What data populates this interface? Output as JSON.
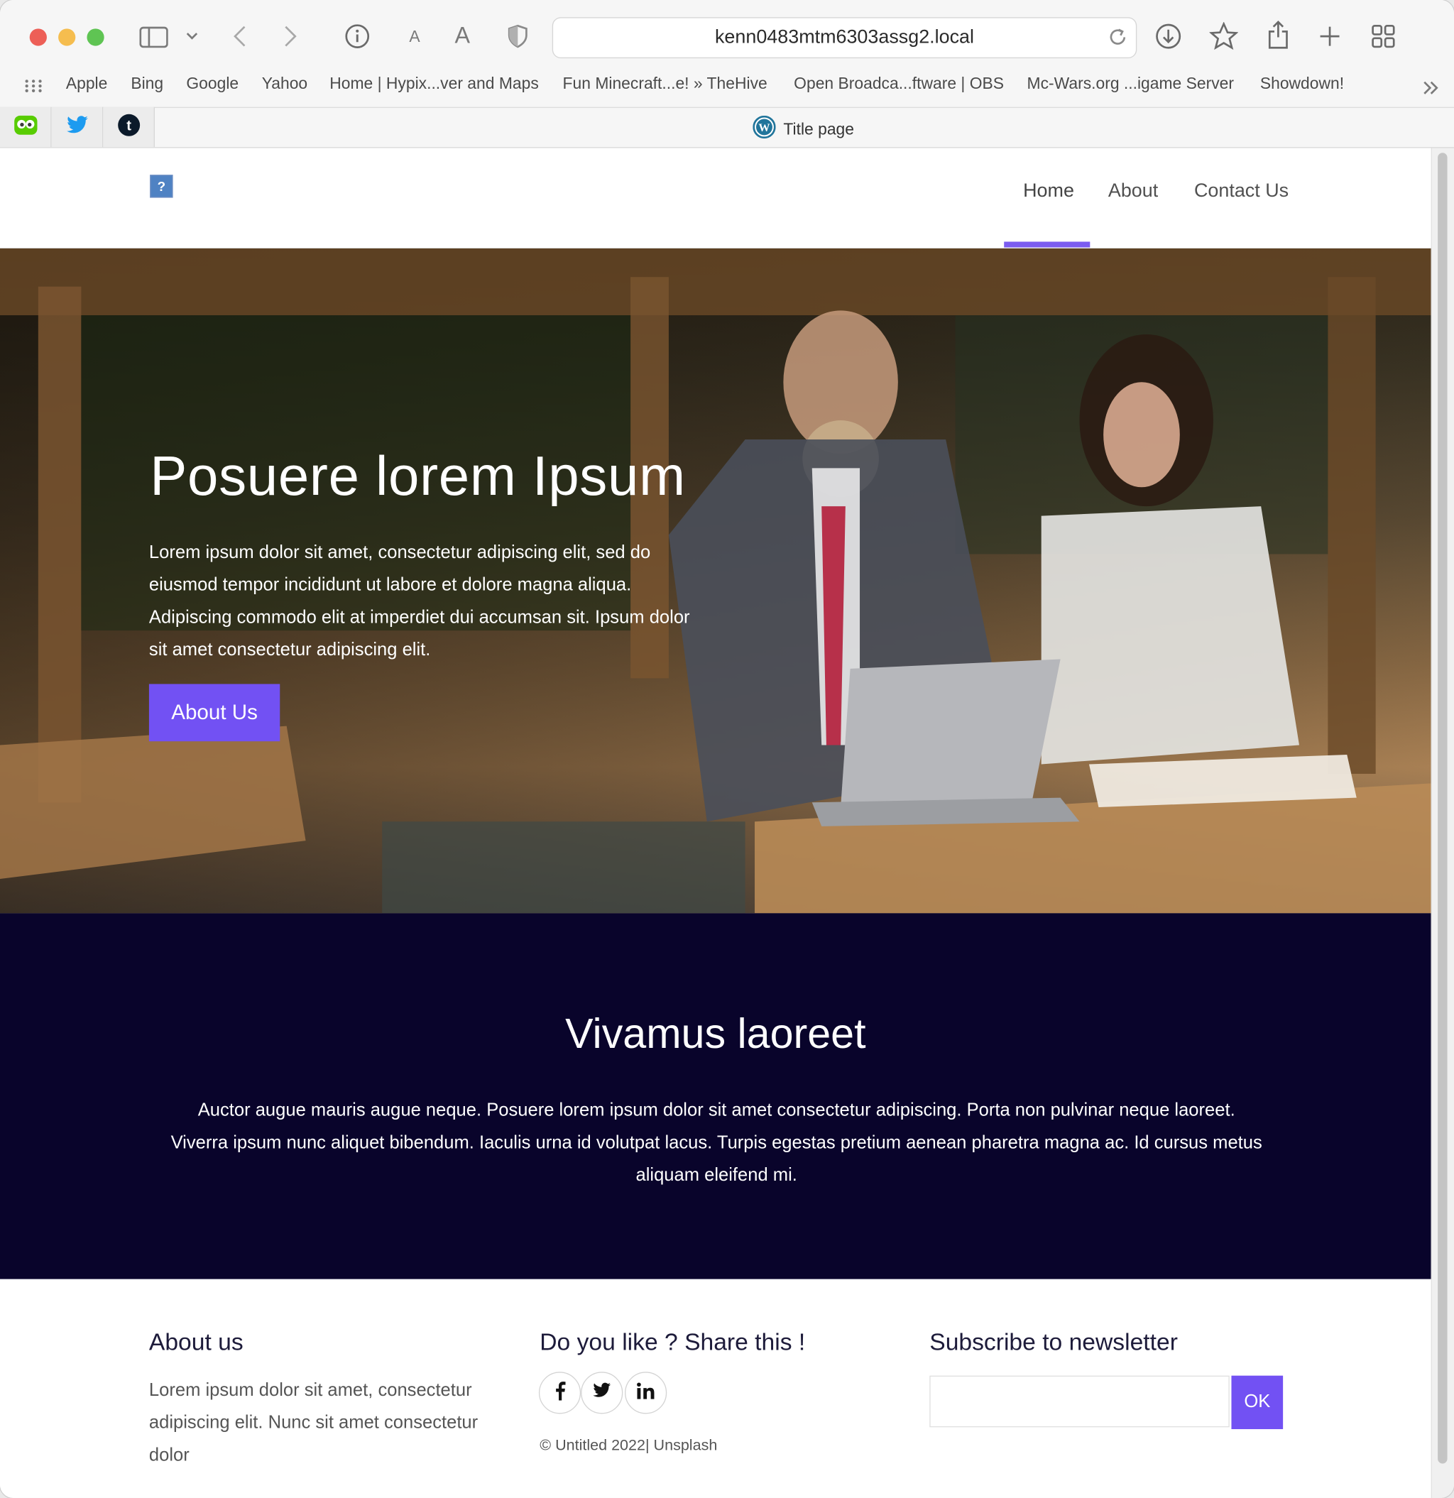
{
  "browser": {
    "url": "kenn0483mtm6303assg2.local",
    "tab_title": "Title page",
    "bookmarks": [
      "Apple",
      "Bing",
      "Google",
      "Yahoo",
      "Home | Hypix...ver and Maps",
      "Fun Minecraft...e! » TheHive",
      "Open Broadca...ftware | OBS",
      "Mc-Wars.org ...igame Server",
      "Showdown!"
    ],
    "text_size_small": "A",
    "text_size_large": "A",
    "pinned_tabs": [
      "duolingo-icon",
      "twitter-icon",
      "tumblr-icon"
    ]
  },
  "header": {
    "logo_glyph": "?",
    "nav": [
      {
        "label": "Home",
        "active": true
      },
      {
        "label": "About",
        "active": false
      },
      {
        "label": "Contact Us",
        "active": false
      }
    ]
  },
  "hero": {
    "title": "Posuere lorem Ipsum",
    "text": "Lorem ipsum dolor sit amet, consectetur adipiscing elit, sed do eiusmod tempor incididunt ut labore et dolore magna aliqua. Adipiscing commodo elit at imperdiet dui accumsan sit. Ipsum dolor sit amet consectetur adipiscing elit.",
    "button": "About Us"
  },
  "band": {
    "title": "Vivamus laoreet",
    "text": "Auctor augue mauris augue neque. Posuere lorem ipsum dolor sit amet consectetur adipiscing. Porta non pulvinar neque laoreet. Viverra ipsum nunc aliquet bibendum. Iaculis urna id volutpat lacus. Turpis egestas pretium aenean pharetra magna ac. Id cursus metus aliquam eleifend mi."
  },
  "footer": {
    "about_heading": "About us",
    "about_text": "Lorem ipsum dolor sit amet, consectetur adipiscing elit. Nunc sit amet consectetur dolor",
    "share_heading": "Do you like ? Share this !",
    "social": [
      "facebook-icon",
      "twitter-icon",
      "linkedin-icon"
    ],
    "copyright": "© Untitled 2022| Unsplash",
    "newsletter_heading": "Subscribe to newsletter",
    "newsletter_placeholder": "",
    "newsletter_button": "OK"
  },
  "colors": {
    "accent": "#7251f3",
    "band_bg": "#09042b",
    "close": "#ed5f57",
    "minimize": "#f5bd4f",
    "zoom": "#5fc453"
  }
}
